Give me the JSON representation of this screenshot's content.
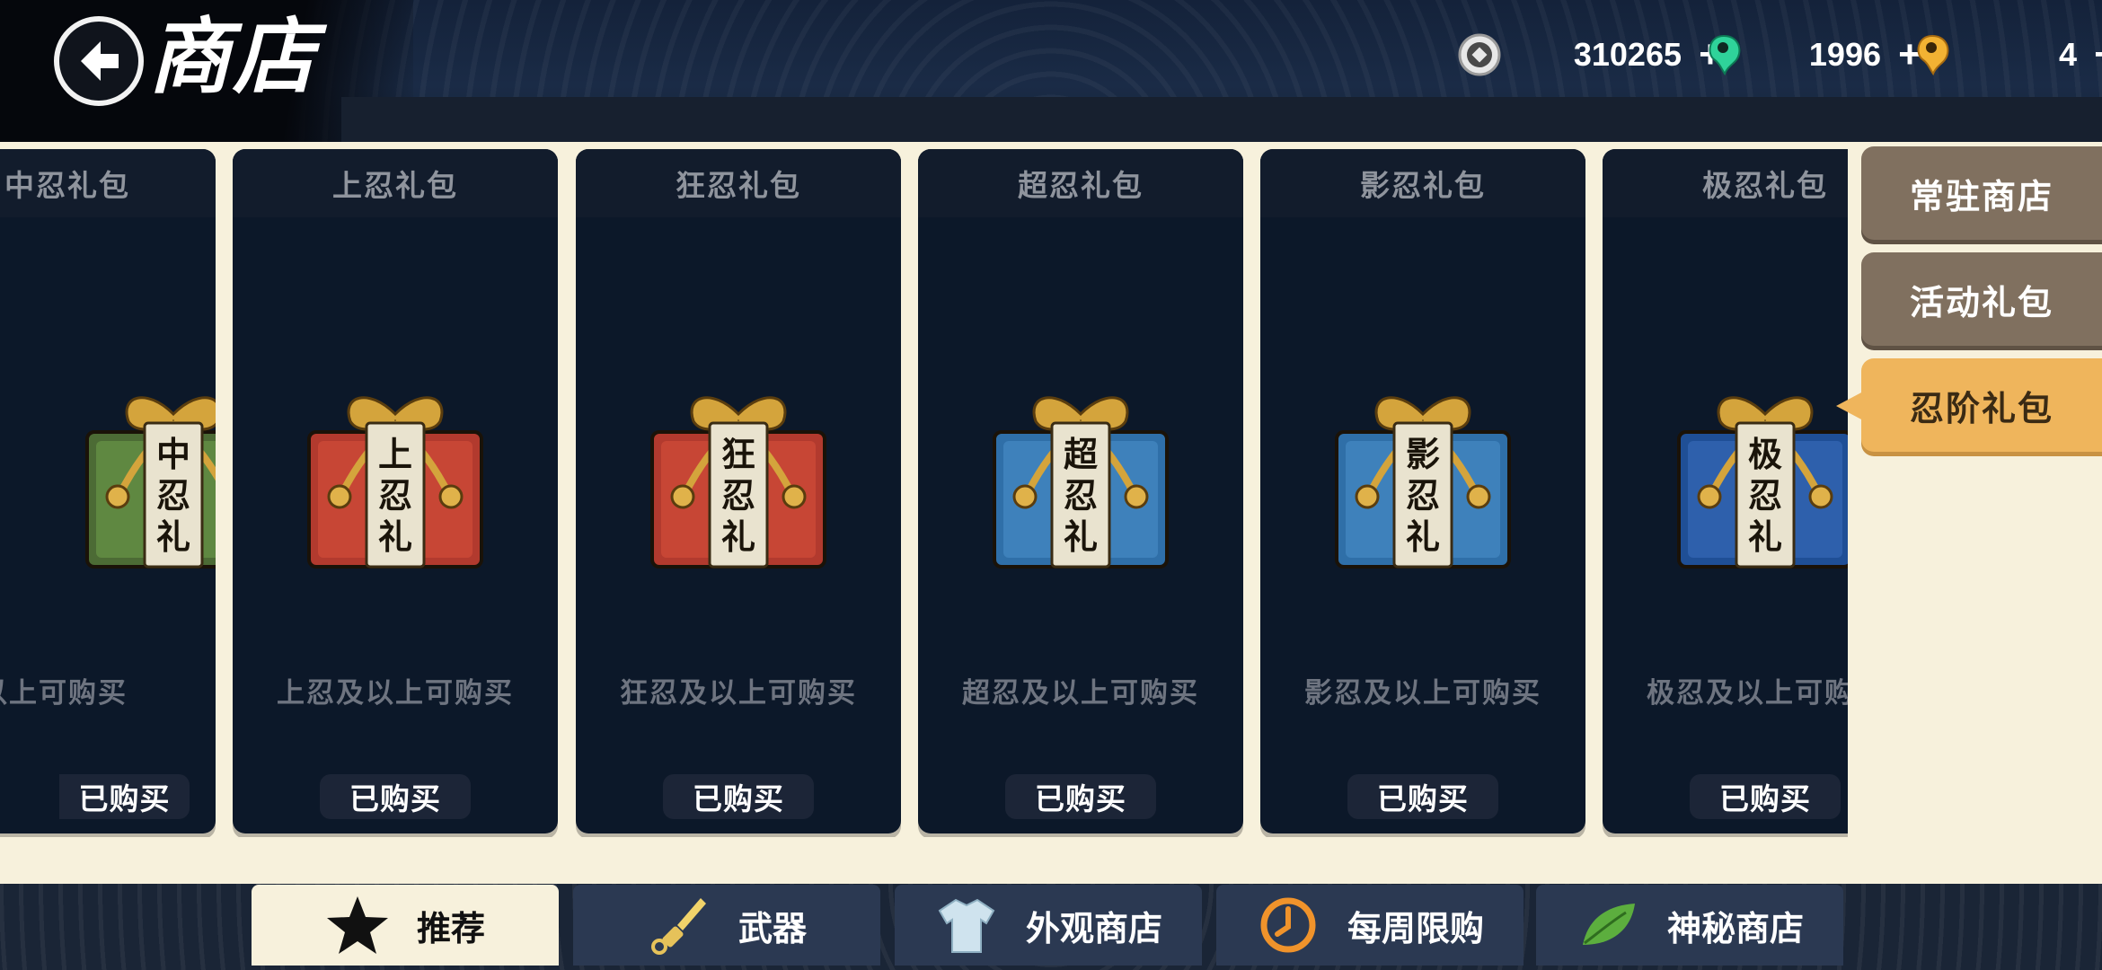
{
  "header": {
    "title": "商店",
    "back_icon": "back-arrow-icon"
  },
  "currencies": [
    {
      "icon": "coin-icon",
      "value": "310265",
      "plus": "+"
    },
    {
      "icon": "green-magatama-icon",
      "value": "1996",
      "plus": "+"
    },
    {
      "icon": "gold-magatama-icon",
      "value": "4",
      "plus": "+"
    }
  ],
  "packs": [
    {
      "title": "中忍礼包",
      "seal": [
        "中",
        "忍",
        "礼"
      ],
      "condition": "中忍及以上可购买",
      "button": "已购买",
      "box_color": "#4c6b35",
      "accent": "#6fa04a"
    },
    {
      "title": "上忍礼包",
      "seal": [
        "上",
        "忍",
        "礼"
      ],
      "condition": "上忍及以上可购买",
      "button": "已购买",
      "box_color": "#b23a2e",
      "accent": "#d8513d"
    },
    {
      "title": "狂忍礼包",
      "seal": [
        "狂",
        "忍",
        "礼"
      ],
      "condition": "狂忍及以上可购买",
      "button": "已购买",
      "box_color": "#b23a2e",
      "accent": "#d8513d"
    },
    {
      "title": "超忍礼包",
      "seal": [
        "超",
        "忍",
        "礼"
      ],
      "condition": "超忍及以上可购买",
      "button": "已购买",
      "box_color": "#2f6fa8",
      "accent": "#4b8fcb"
    },
    {
      "title": "影忍礼包",
      "seal": [
        "影",
        "忍",
        "礼"
      ],
      "condition": "影忍及以上可购买",
      "button": "已购买",
      "box_color": "#2f6fa8",
      "accent": "#4b8fcb"
    },
    {
      "title": "极忍礼包",
      "seal": [
        "极",
        "忍",
        "礼"
      ],
      "condition": "极忍及以上可购买",
      "button": "已购买",
      "box_color": "#1f4f96",
      "accent": "#3a6fc0"
    }
  ],
  "side_tabs": [
    {
      "label": "常驻商店",
      "active": false
    },
    {
      "label": "活动礼包",
      "active": false
    },
    {
      "label": "忍阶礼包",
      "active": true
    }
  ],
  "bottom_tabs": [
    {
      "label": "推荐",
      "icon": "star-icon",
      "active": true
    },
    {
      "label": "武器",
      "icon": "kunai-icon",
      "active": false
    },
    {
      "label": "外观商店",
      "icon": "shirt-icon",
      "active": false
    },
    {
      "label": "每周限购",
      "icon": "clock-icon",
      "active": false
    },
    {
      "label": "神秘商店",
      "icon": "leaf-icon",
      "active": false
    }
  ]
}
